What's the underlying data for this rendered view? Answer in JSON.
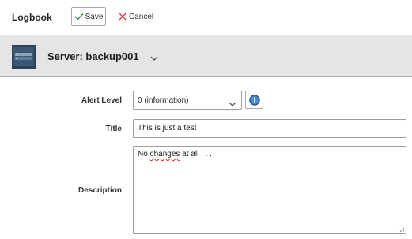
{
  "toolbar": {
    "title": "Logbook",
    "save_label": "Save",
    "cancel_label": "Cancel"
  },
  "server_bar": {
    "title": "Server: backup001",
    "icon": "server-rack-image",
    "chevron_icon": "chevron-down-icon"
  },
  "form": {
    "alert_level": {
      "label": "Alert Level",
      "selected": "0 (information)"
    },
    "title": {
      "label": "Title",
      "value": "This is just a test"
    },
    "description": {
      "label": "Description",
      "value_part1": "No",
      "value_misspelled": "changes",
      "value_part2": "at all . . ."
    }
  },
  "colors": {
    "save_check": "#2a8a2a",
    "cancel_x": "#d23a3a",
    "info_blue": "#2f6fb5",
    "server_bar_bg": "#e4e5e5"
  }
}
